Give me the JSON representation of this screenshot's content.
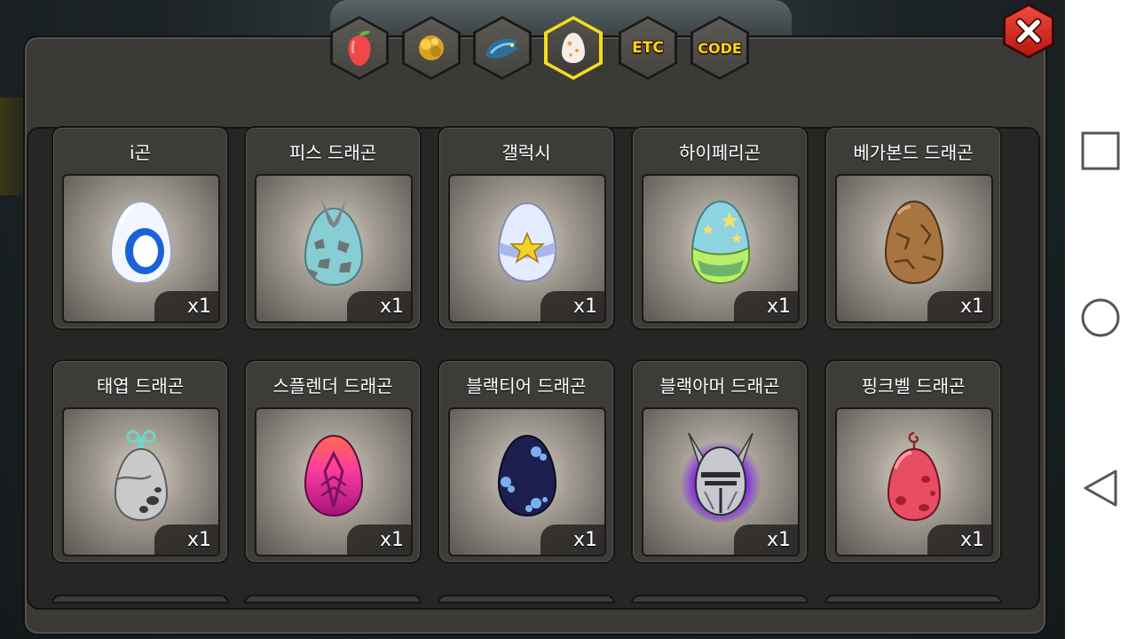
{
  "tabs": [
    {
      "id": "fruit",
      "icon": "fruit-icon",
      "label": ""
    },
    {
      "id": "gold",
      "icon": "gold-nugget-icon",
      "label": ""
    },
    {
      "id": "dragon",
      "icon": "dragon-icon",
      "label": ""
    },
    {
      "id": "egg",
      "icon": "egg-icon",
      "label": "",
      "active": true
    },
    {
      "id": "etc",
      "icon": "",
      "label": "ETC"
    },
    {
      "id": "code",
      "icon": "",
      "label": "CODE"
    }
  ],
  "items": [
    {
      "name": "i곤",
      "qty": "x1",
      "icon": "i-gon-egg-icon",
      "colors": {
        "shell": "#f2f6ff",
        "accent": "#1a63d6"
      }
    },
    {
      "name": "피스 드래곤",
      "qty": "x1",
      "icon": "piece-dragon-egg-icon",
      "colors": {
        "shell": "#88cdd3",
        "accent": "#6b7478"
      }
    },
    {
      "name": "갤럭시",
      "qty": "x1",
      "icon": "galaxy-egg-icon",
      "colors": {
        "shell": "#e6ecff",
        "accent": "#f5d22a"
      }
    },
    {
      "name": "하이페리곤",
      "qty": "x1",
      "icon": "hyperigon-egg-icon",
      "colors": {
        "shell": "#8ed4e0",
        "accent": "#b8ef6a"
      }
    },
    {
      "name": "베가본드 드래곤",
      "qty": "x1",
      "icon": "vagabond-dragon-egg-icon",
      "colors": {
        "shell": "#a8743f",
        "accent": "#5a3c1c"
      }
    },
    {
      "name": "태엽 드래곤",
      "qty": "x1",
      "icon": "clockwork-dragon-egg-icon",
      "colors": {
        "shell": "#c9c9c9",
        "accent": "#6ed6c4"
      }
    },
    {
      "name": "스플렌더 드래곤",
      "qty": "x1",
      "icon": "splendor-dragon-egg-icon",
      "colors": {
        "shell": "#ff3f9d",
        "accent": "#c2177a"
      }
    },
    {
      "name": "블랙티어 드래곤",
      "qty": "x1",
      "icon": "blacktear-dragon-egg-icon",
      "colors": {
        "shell": "#1c1f4e",
        "accent": "#7bb0f0"
      }
    },
    {
      "name": "블랙아머 드래곤",
      "qty": "x1",
      "icon": "blackarmor-dragon-egg-icon",
      "colors": {
        "shell": "#c8c8d0",
        "accent": "#8a2cff"
      }
    },
    {
      "name": "핑크벨 드래곤",
      "qty": "x1",
      "icon": "pinkbell-dragon-egg-icon",
      "colors": {
        "shell": "#e84d63",
        "accent": "#a31f30"
      }
    }
  ],
  "nav": {
    "recent": "recent-apps-icon",
    "home": "home-icon",
    "back": "back-icon"
  }
}
